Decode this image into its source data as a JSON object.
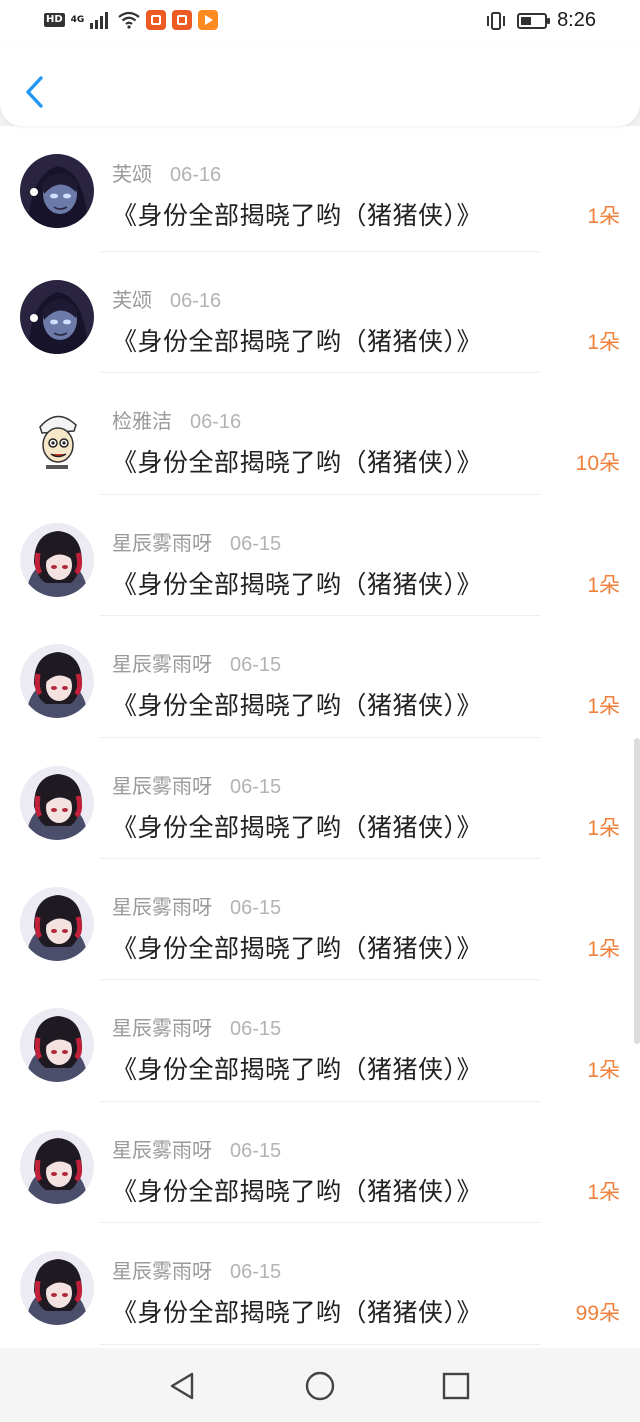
{
  "status_bar": {
    "hd": "HD",
    "network": "4G",
    "time": "8:26",
    "battery_level": 0.45
  },
  "header": {
    "back_icon": "chevron-left-icon"
  },
  "gift_list": [
    {
      "user": "芙颂",
      "date": "06-16",
      "title": "《身份全部揭晓了哟（猪猪侠）》",
      "count": "1朵",
      "avatar": "dark-hair-avatar"
    },
    {
      "user": "芙颂",
      "date": "06-16",
      "title": "《身份全部揭晓了哟（猪猪侠）》",
      "count": "1朵",
      "avatar": "dark-hair-avatar"
    },
    {
      "user": "检雅洁",
      "date": "06-16",
      "title": "《身份全部揭晓了哟（猪猪侠）》",
      "count": "10朵",
      "avatar": "cartoon-avatar"
    },
    {
      "user": "星辰雾雨呀",
      "date": "06-15",
      "title": "《身份全部揭晓了哟（猪猪侠）》",
      "count": "1朵",
      "avatar": "headphone-girl-avatar"
    },
    {
      "user": "星辰雾雨呀",
      "date": "06-15",
      "title": "《身份全部揭晓了哟（猪猪侠）》",
      "count": "1朵",
      "avatar": "headphone-girl-avatar"
    },
    {
      "user": "星辰雾雨呀",
      "date": "06-15",
      "title": "《身份全部揭晓了哟（猪猪侠）》",
      "count": "1朵",
      "avatar": "headphone-girl-avatar"
    },
    {
      "user": "星辰雾雨呀",
      "date": "06-15",
      "title": "《身份全部揭晓了哟（猪猪侠）》",
      "count": "1朵",
      "avatar": "headphone-girl-avatar"
    },
    {
      "user": "星辰雾雨呀",
      "date": "06-15",
      "title": "《身份全部揭晓了哟（猪猪侠）》",
      "count": "1朵",
      "avatar": "headphone-girl-avatar"
    },
    {
      "user": "星辰雾雨呀",
      "date": "06-15",
      "title": "《身份全部揭晓了哟（猪猪侠）》",
      "count": "1朵",
      "avatar": "headphone-girl-avatar"
    },
    {
      "user": "星辰雾雨呀",
      "date": "06-15",
      "title": "《身份全部揭晓了哟（猪猪侠）》",
      "count": "99朵",
      "avatar": "headphone-girl-avatar"
    }
  ],
  "nav_bar": {
    "back": "triangle-back-icon",
    "home": "circle-home-icon",
    "recents": "square-recents-icon"
  },
  "colors": {
    "accent_blue": "#2196f3",
    "count_orange": "#f0803c",
    "username_gray": "#9a9a9a"
  }
}
